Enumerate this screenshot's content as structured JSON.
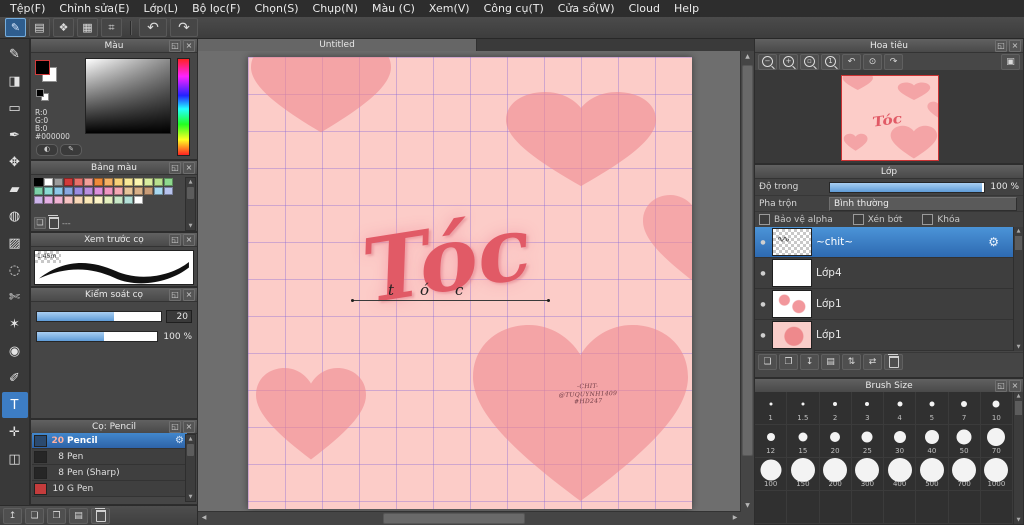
{
  "menu": {
    "items": [
      "Tệp(F)",
      "Chỉnh sửa(E)",
      "Lớp(L)",
      "Bộ lọc(F)",
      "Chọn(S)",
      "Chụp(N)",
      "Màu (C)",
      "Xem(V)",
      "Công cụ(T)",
      "Cửa sổ(W)",
      "Cloud",
      "Help"
    ]
  },
  "ui": {
    "float_glyph": "◱",
    "close_glyph": "×",
    "gear_glyph": "⚙",
    "eye_glyph": "●",
    "arrow_up": "▲",
    "arrow_down": "▼",
    "arrow_left": "◀",
    "arrow_right": "▶"
  },
  "toolbar": {
    "undo_glyph": "↶",
    "redo_glyph": "↷",
    "buttons": [
      {
        "name": "brush-mode",
        "icon": "pen-icon",
        "glyph": "✎",
        "selected": true
      },
      {
        "name": "save",
        "icon": "save-icon",
        "glyph": "▤"
      },
      {
        "name": "comment",
        "icon": "chat-icon",
        "glyph": "❖"
      },
      {
        "name": "screen",
        "icon": "screen-icon",
        "glyph": "▦"
      },
      {
        "name": "grid",
        "icon": "grid-icon",
        "glyph": "⌗"
      }
    ]
  },
  "toolstrip": [
    {
      "name": "brush-tool",
      "glyph": "✎"
    },
    {
      "name": "eraser-tool",
      "glyph": "◨"
    },
    {
      "name": "marquee-tool",
      "glyph": "▭"
    },
    {
      "name": "pen-tool",
      "glyph": "✒"
    },
    {
      "name": "move-tool",
      "glyph": "✥"
    },
    {
      "name": "fill-rect-tool",
      "glyph": "▰"
    },
    {
      "name": "bucket-tool",
      "glyph": "◍"
    },
    {
      "name": "gradient-tool",
      "glyph": "▨"
    },
    {
      "name": "select-tool",
      "glyph": "◌"
    },
    {
      "name": "lasso-tool",
      "glyph": "✄"
    },
    {
      "name": "magic-wand-tool",
      "glyph": "✶"
    },
    {
      "name": "eyedropper-tool",
      "glyph": "◉"
    },
    {
      "name": "select-pen-tool",
      "glyph": "✐"
    },
    {
      "name": "text-tool",
      "glyph": "T",
      "selected": true
    },
    {
      "name": "hand-tool",
      "glyph": "✛"
    },
    {
      "name": "frame-tool",
      "glyph": "◫"
    }
  ],
  "color_panel": {
    "title": "Màu",
    "r": "R:0",
    "g": "G:0",
    "b": "B:0",
    "hex": "#000000"
  },
  "palette_panel": {
    "title": "Bảng màu",
    "footer": "---",
    "colors": [
      "#000000",
      "#ffffff",
      "#9c9c9c",
      "#d13a3a",
      "#e8716b",
      "#f2a09a",
      "#ef8a3a",
      "#f4b164",
      "#f7d178",
      "#f9e998",
      "#fbf7b0",
      "#d9eda0",
      "#b8e08e",
      "#8ed98e",
      "#7ccfa8",
      "#8adbd3",
      "#8cc8e8",
      "#88a8e0",
      "#9a8ce0",
      "#b98ede",
      "#dc90dc",
      "#ee96c2",
      "#f4a8b4",
      "#e6c49a",
      "#d8b088",
      "#c89c78",
      "#a8d8f0",
      "#b8c4ee",
      "#ccb4ea",
      "#e4b0e4",
      "#f0b4d4",
      "#f6c4c4",
      "#f8d8b8",
      "#fae8b8",
      "#fcf4c8",
      "#e4f0c0",
      "#c8e8c8",
      "#b4e0d8",
      "#ffffff"
    ]
  },
  "preview_panel": {
    "title": "Xem trước cọ",
    "scale_label": "1.45m"
  },
  "control_panel": {
    "title": "Kiểm soát cọ",
    "size_value": "20",
    "opacity_value": "100 %"
  },
  "brush_panel": {
    "title": "Cọ: Pencil",
    "items": [
      {
        "size": "20",
        "name": "Pencil",
        "selected": true,
        "chip": "#2b4a6f"
      },
      {
        "size": "8",
        "name": "Pen",
        "chip": "#262626"
      },
      {
        "size": "8",
        "name": "Pen (Sharp)",
        "chip": "#262626"
      },
      {
        "size": "10",
        "name": "G Pen",
        "chip": "#c43c3c"
      }
    ]
  },
  "bottom_bar": {
    "buttons": [
      {
        "name": "canvas-up-icon",
        "glyph": "↥"
      },
      {
        "name": "new-canvas-icon",
        "glyph": "❏"
      },
      {
        "name": "duplicate-canvas-icon",
        "glyph": "❐"
      },
      {
        "name": "folder-icon",
        "glyph": "▤"
      },
      {
        "name": "delete-icon",
        "glyph": "trash"
      }
    ]
  },
  "canvas": {
    "tab": "Untitled",
    "word": "Tóc",
    "word_color": "#e15a66",
    "small_word": "tóc",
    "signature": [
      "-CHIT-",
      "@TUQUYNH1409",
      "#HD247"
    ],
    "bg": "#fcccc8",
    "heart": "#ee8890",
    "grid_line": "#8769d7"
  },
  "navigator": {
    "title": "Hoa tiêu",
    "buttons": [
      {
        "name": "zoom-out-icon",
        "type": "mag",
        "sign": "−"
      },
      {
        "name": "zoom-in-icon",
        "type": "mag",
        "sign": "+"
      },
      {
        "name": "zoom-fit-icon",
        "type": "mag",
        "sign": "▫"
      },
      {
        "name": "zoom-actual-icon",
        "type": "mag",
        "sign": "1"
      },
      {
        "name": "rotate-left-icon",
        "type": "glyph",
        "glyph": "↶"
      },
      {
        "name": "rotate-reset-icon",
        "type": "glyph",
        "glyph": "⊙"
      },
      {
        "name": "rotate-right-icon",
        "type": "glyph",
        "glyph": "↷"
      },
      {
        "name": "spread-view-icon",
        "type": "glyph",
        "glyph": "▣",
        "right": true
      }
    ]
  },
  "layers_panel": {
    "title": "Lớp",
    "opacity_label": "Độ trong",
    "opacity_value": "100 %",
    "blend_label": "Pha trộn",
    "blend_value": "Bình thường",
    "check_alpha": "Bảo vệ alpha",
    "check_clip": "Xén bớt",
    "check_lock": "Khóa",
    "items": [
      {
        "name": "~chit~",
        "selected": true,
        "thumb": "checker"
      },
      {
        "name": "Lớp4",
        "thumb": "white"
      },
      {
        "name": "Lớp1",
        "thumb": "hearts"
      },
      {
        "name": "Lớp1",
        "thumb": "pink"
      }
    ],
    "buttons": [
      {
        "name": "add-layer-icon",
        "glyph": "❏"
      },
      {
        "name": "duplicate-layer-icon",
        "glyph": "❐"
      },
      {
        "name": "merge-down-icon",
        "glyph": "↧"
      },
      {
        "name": "add-folder-icon",
        "glyph": "▤"
      },
      {
        "name": "reorder-layer-icon",
        "glyph": "⇅"
      },
      {
        "name": "transfer-layer-icon",
        "glyph": "⇄"
      },
      {
        "name": "delete-layer-icon",
        "glyph": "trash"
      }
    ]
  },
  "brush_size_panel": {
    "title": "Brush Size",
    "sizes": [
      "1",
      "1.5",
      "2",
      "3",
      "4",
      "5",
      "7",
      "10",
      "12",
      "15",
      "20",
      "25",
      "30",
      "40",
      "50",
      "70",
      "100",
      "150",
      "200",
      "300",
      "400",
      "500",
      "700",
      "1000"
    ]
  },
  "colors": {
    "accent_blue": "#3d7dc4",
    "selection_blue": "#3579b8",
    "slider_blue": "#5f9cd8",
    "canvas_pink": "#fcccc8",
    "heart_pink": "#ee8890",
    "grid_purple": "#8769d7",
    "viewport_frame_red": "#cc3333"
  }
}
